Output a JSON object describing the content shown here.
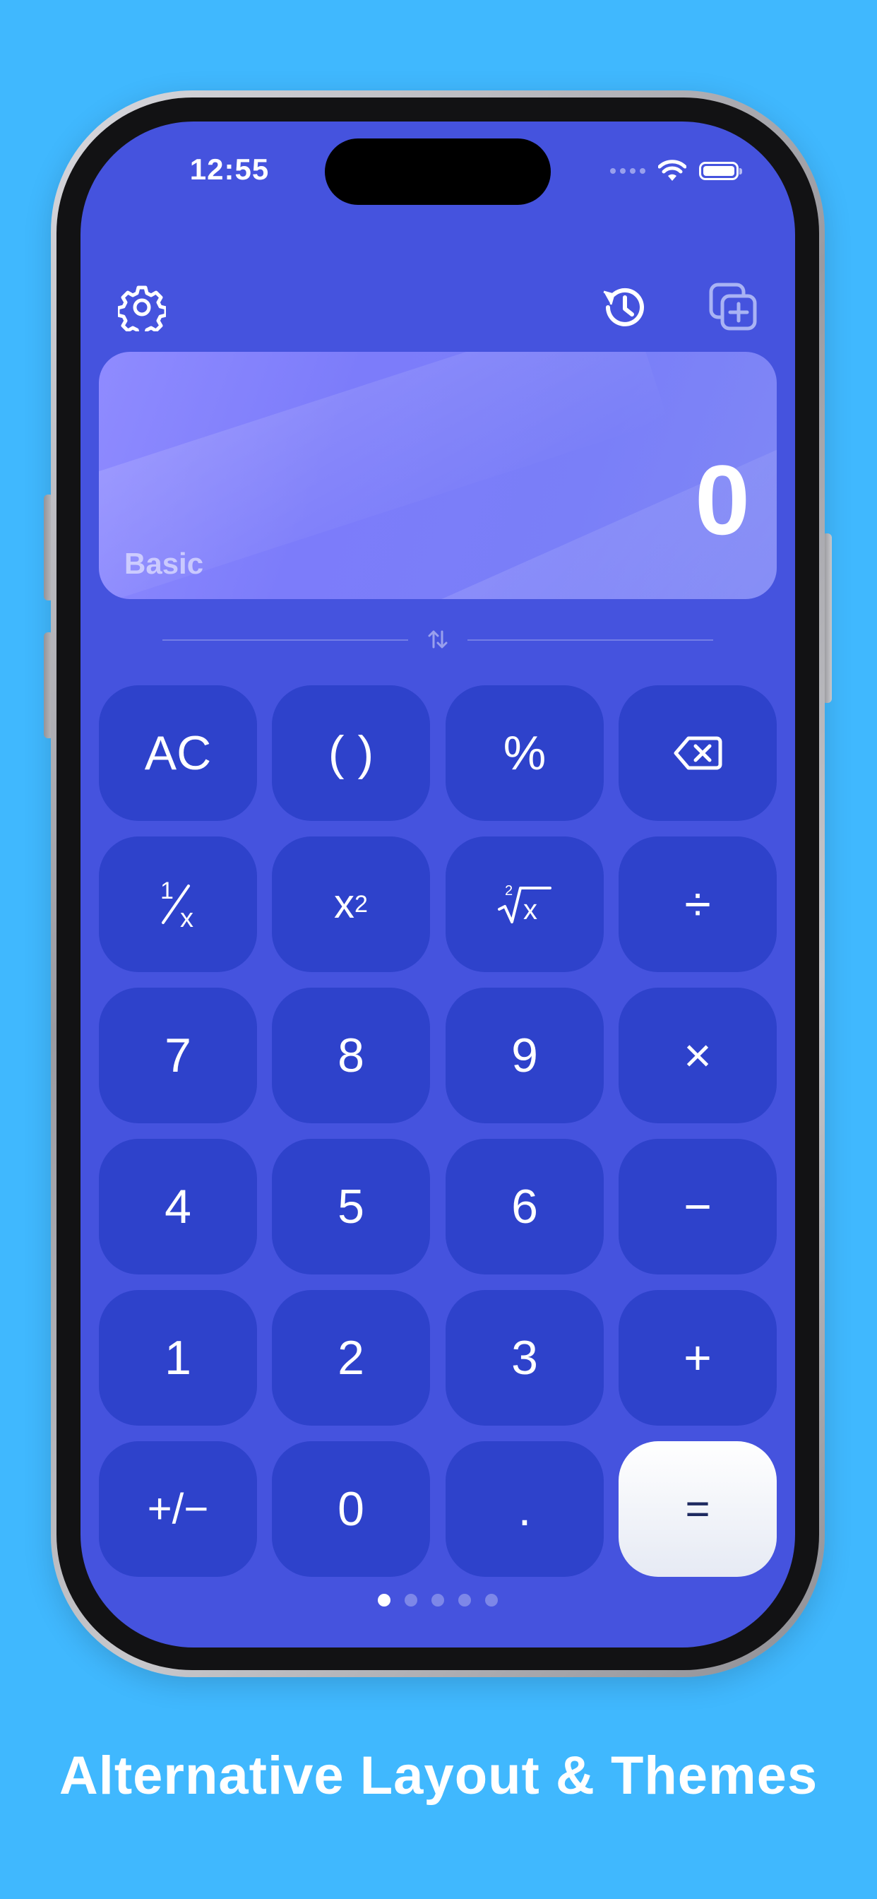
{
  "status_bar": {
    "time": "12:55"
  },
  "toolbar": {
    "settings_icon": "gear-icon",
    "history_icon": "history-icon",
    "new_window_icon": "add-copy-icon"
  },
  "display": {
    "value": "0",
    "mode": "Basic"
  },
  "keypad": {
    "row1": [
      "AC",
      "( )",
      "%",
      "backspace"
    ],
    "row2": [
      "1/x",
      "x²",
      "√x",
      "÷"
    ],
    "row3": [
      "7",
      "8",
      "9",
      "×"
    ],
    "row4": [
      "4",
      "5",
      "6",
      "−"
    ],
    "row5": [
      "1",
      "2",
      "3",
      "+"
    ],
    "row6": [
      "+/−",
      "0",
      ".",
      "="
    ]
  },
  "pager": {
    "pages": 5,
    "active": 1
  },
  "caption": "Alternative Layout & Themes",
  "colors": {
    "background": "#40b8fe",
    "screen": "#4553de",
    "key": "#2e42cb",
    "equals_key": "#ffffff",
    "display": "#7c7cfa"
  }
}
